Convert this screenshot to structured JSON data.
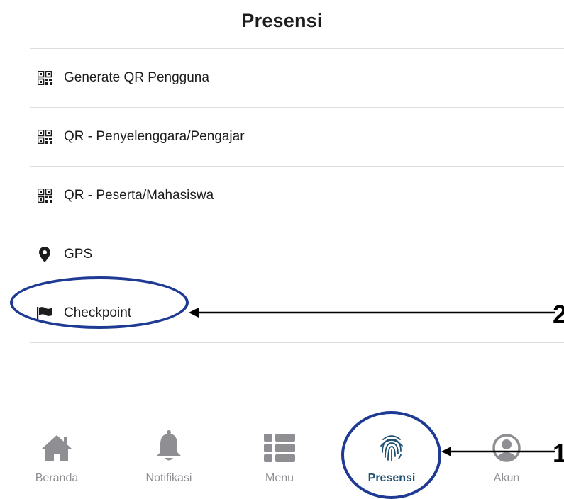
{
  "header": {
    "title": "Presensi"
  },
  "menu": {
    "items": [
      {
        "label": "Generate QR Pengguna",
        "icon": "qr-code-icon"
      },
      {
        "label": "QR - Penyelenggara/Pengajar",
        "icon": "qr-code-icon"
      },
      {
        "label": "QR - Peserta/Mahasiswa",
        "icon": "qr-code-icon"
      },
      {
        "label": "GPS",
        "icon": "location-pin-icon"
      },
      {
        "label": "Checkpoint",
        "icon": "flag-icon"
      }
    ]
  },
  "annotations": {
    "checkpoint_number": "2",
    "presensi_number": "1",
    "color": "#1f3a93"
  },
  "tabbar": {
    "tabs": [
      {
        "label": "Beranda",
        "icon": "home-icon"
      },
      {
        "label": "Notifikasi",
        "icon": "bell-icon"
      },
      {
        "label": "Menu",
        "icon": "menu-list-icon"
      },
      {
        "label": "Presensi",
        "icon": "fingerprint-icon",
        "active": true
      },
      {
        "label": "Akun",
        "icon": "account-icon"
      }
    ],
    "active_color": "#1f5072",
    "inactive_color": "#8e8e93"
  }
}
